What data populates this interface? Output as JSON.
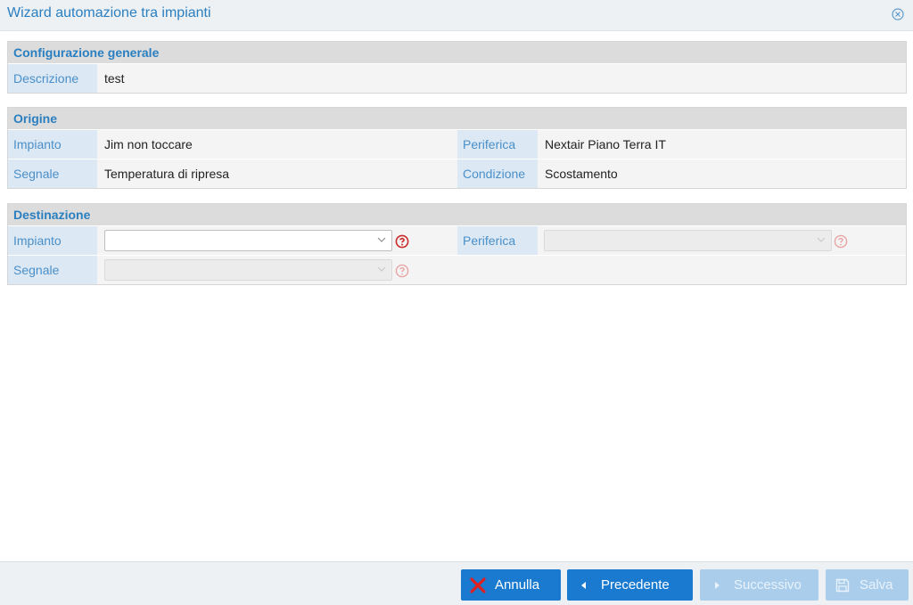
{
  "window": {
    "title": "Wizard automazione tra impianti",
    "close_icon": "close-circle-icon"
  },
  "generale": {
    "heading": "Configurazione generale",
    "descrizione_label": "Descrizione",
    "descrizione_value": "test"
  },
  "origine": {
    "heading": "Origine",
    "impianto_label": "Impianto",
    "impianto_value": "Jim non toccare",
    "periferica_label": "Periferica",
    "periferica_value": "Nextair Piano Terra IT",
    "segnale_label": "Segnale",
    "segnale_value": "Temperatura di ripresa",
    "condizione_label": "Condizione",
    "condizione_value": "Scostamento"
  },
  "destinazione": {
    "heading": "Destinazione",
    "impianto_label": "Impianto",
    "impianto_value": "",
    "periferica_label": "Periferica",
    "periferica_value": "",
    "segnale_label": "Segnale",
    "segnale_value": ""
  },
  "footer": {
    "annulla_label": "Annulla",
    "precedente_label": "Precedente",
    "successivo_label": "Successivo",
    "salva_label": "Salva"
  },
  "colors": {
    "accent": "#2a7fc1",
    "button": "#1a7ad0",
    "button_disabled": "#a9cdeb",
    "help_active": "#cc2a2a",
    "help_disabled": "#e8a3a3",
    "annulla_icon": "#e0201f"
  }
}
